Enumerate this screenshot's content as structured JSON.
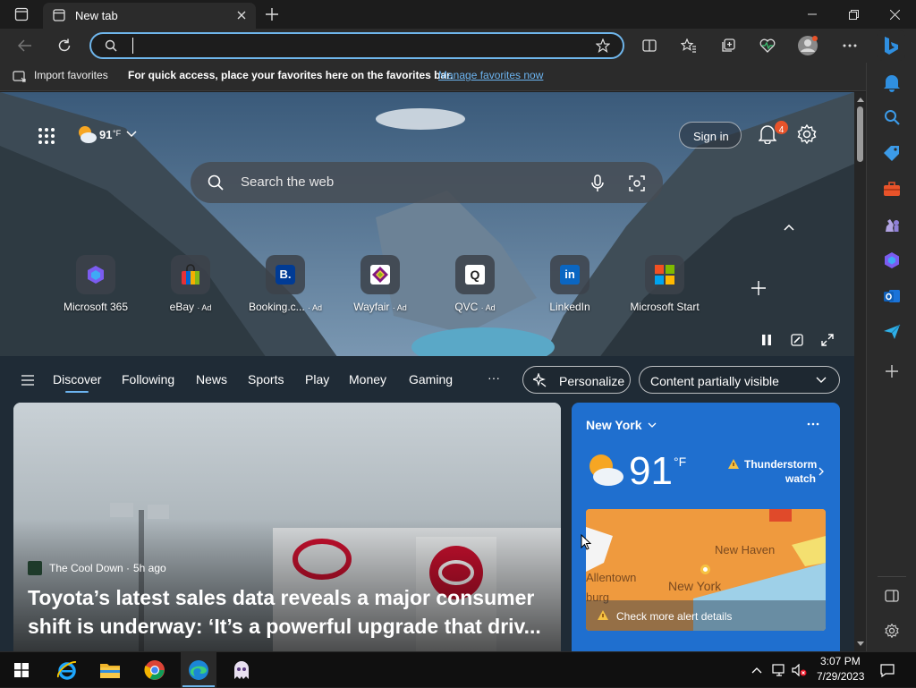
{
  "browser": {
    "tab_title": "New tab",
    "address_value": "",
    "favbar_import": "Import favorites",
    "favbar_hint": "For quick access, place your favorites here on the favorites bar.",
    "favbar_manage": "Manage favorites now"
  },
  "ntp": {
    "weather_temp": "91",
    "weather_unit": "°F",
    "signin": "Sign in",
    "notification_count": "4",
    "search_placeholder": "Search the web",
    "shortcuts": [
      {
        "label": "Microsoft 365",
        "ad": ""
      },
      {
        "label": "eBay",
        "ad": "· Ad"
      },
      {
        "label": "Booking.c...",
        "ad": "· Ad"
      },
      {
        "label": "Wayfair",
        "ad": "· Ad"
      },
      {
        "label": "QVC",
        "ad": "· Ad"
      },
      {
        "label": "LinkedIn",
        "ad": ""
      },
      {
        "label": "Microsoft Start",
        "ad": ""
      }
    ],
    "nav": [
      "Discover",
      "Following",
      "News",
      "Sports",
      "Play",
      "Money",
      "Gaming"
    ],
    "nav_more": "···",
    "personalize": "Personalize",
    "content_visibility": "Content partially visible"
  },
  "news_card": {
    "source": "The Cool Down",
    "age": "5h ago",
    "headline": "Toyota’s latest sales data reveals a major consumer shift is underway: ‘It’s a powerful upgrade that driv..."
  },
  "weather_card": {
    "city": "New York",
    "temp": "91",
    "unit": "°F",
    "alert": "Thunderstorm watch",
    "alert_line1": "Thunderstorm",
    "alert_line2": "watch",
    "map_labels": [
      "New Haven",
      "Allentown",
      "New York",
      "burg"
    ],
    "more_alerts": "Check more alert details"
  },
  "taskbar": {
    "time": "3:07 PM",
    "date": "7/29/2023"
  },
  "colors": {
    "accent": "#6fb6ec",
    "link": "#6cb4f0",
    "weather_card": "#1f6fcf",
    "badge": "#e8532a"
  }
}
